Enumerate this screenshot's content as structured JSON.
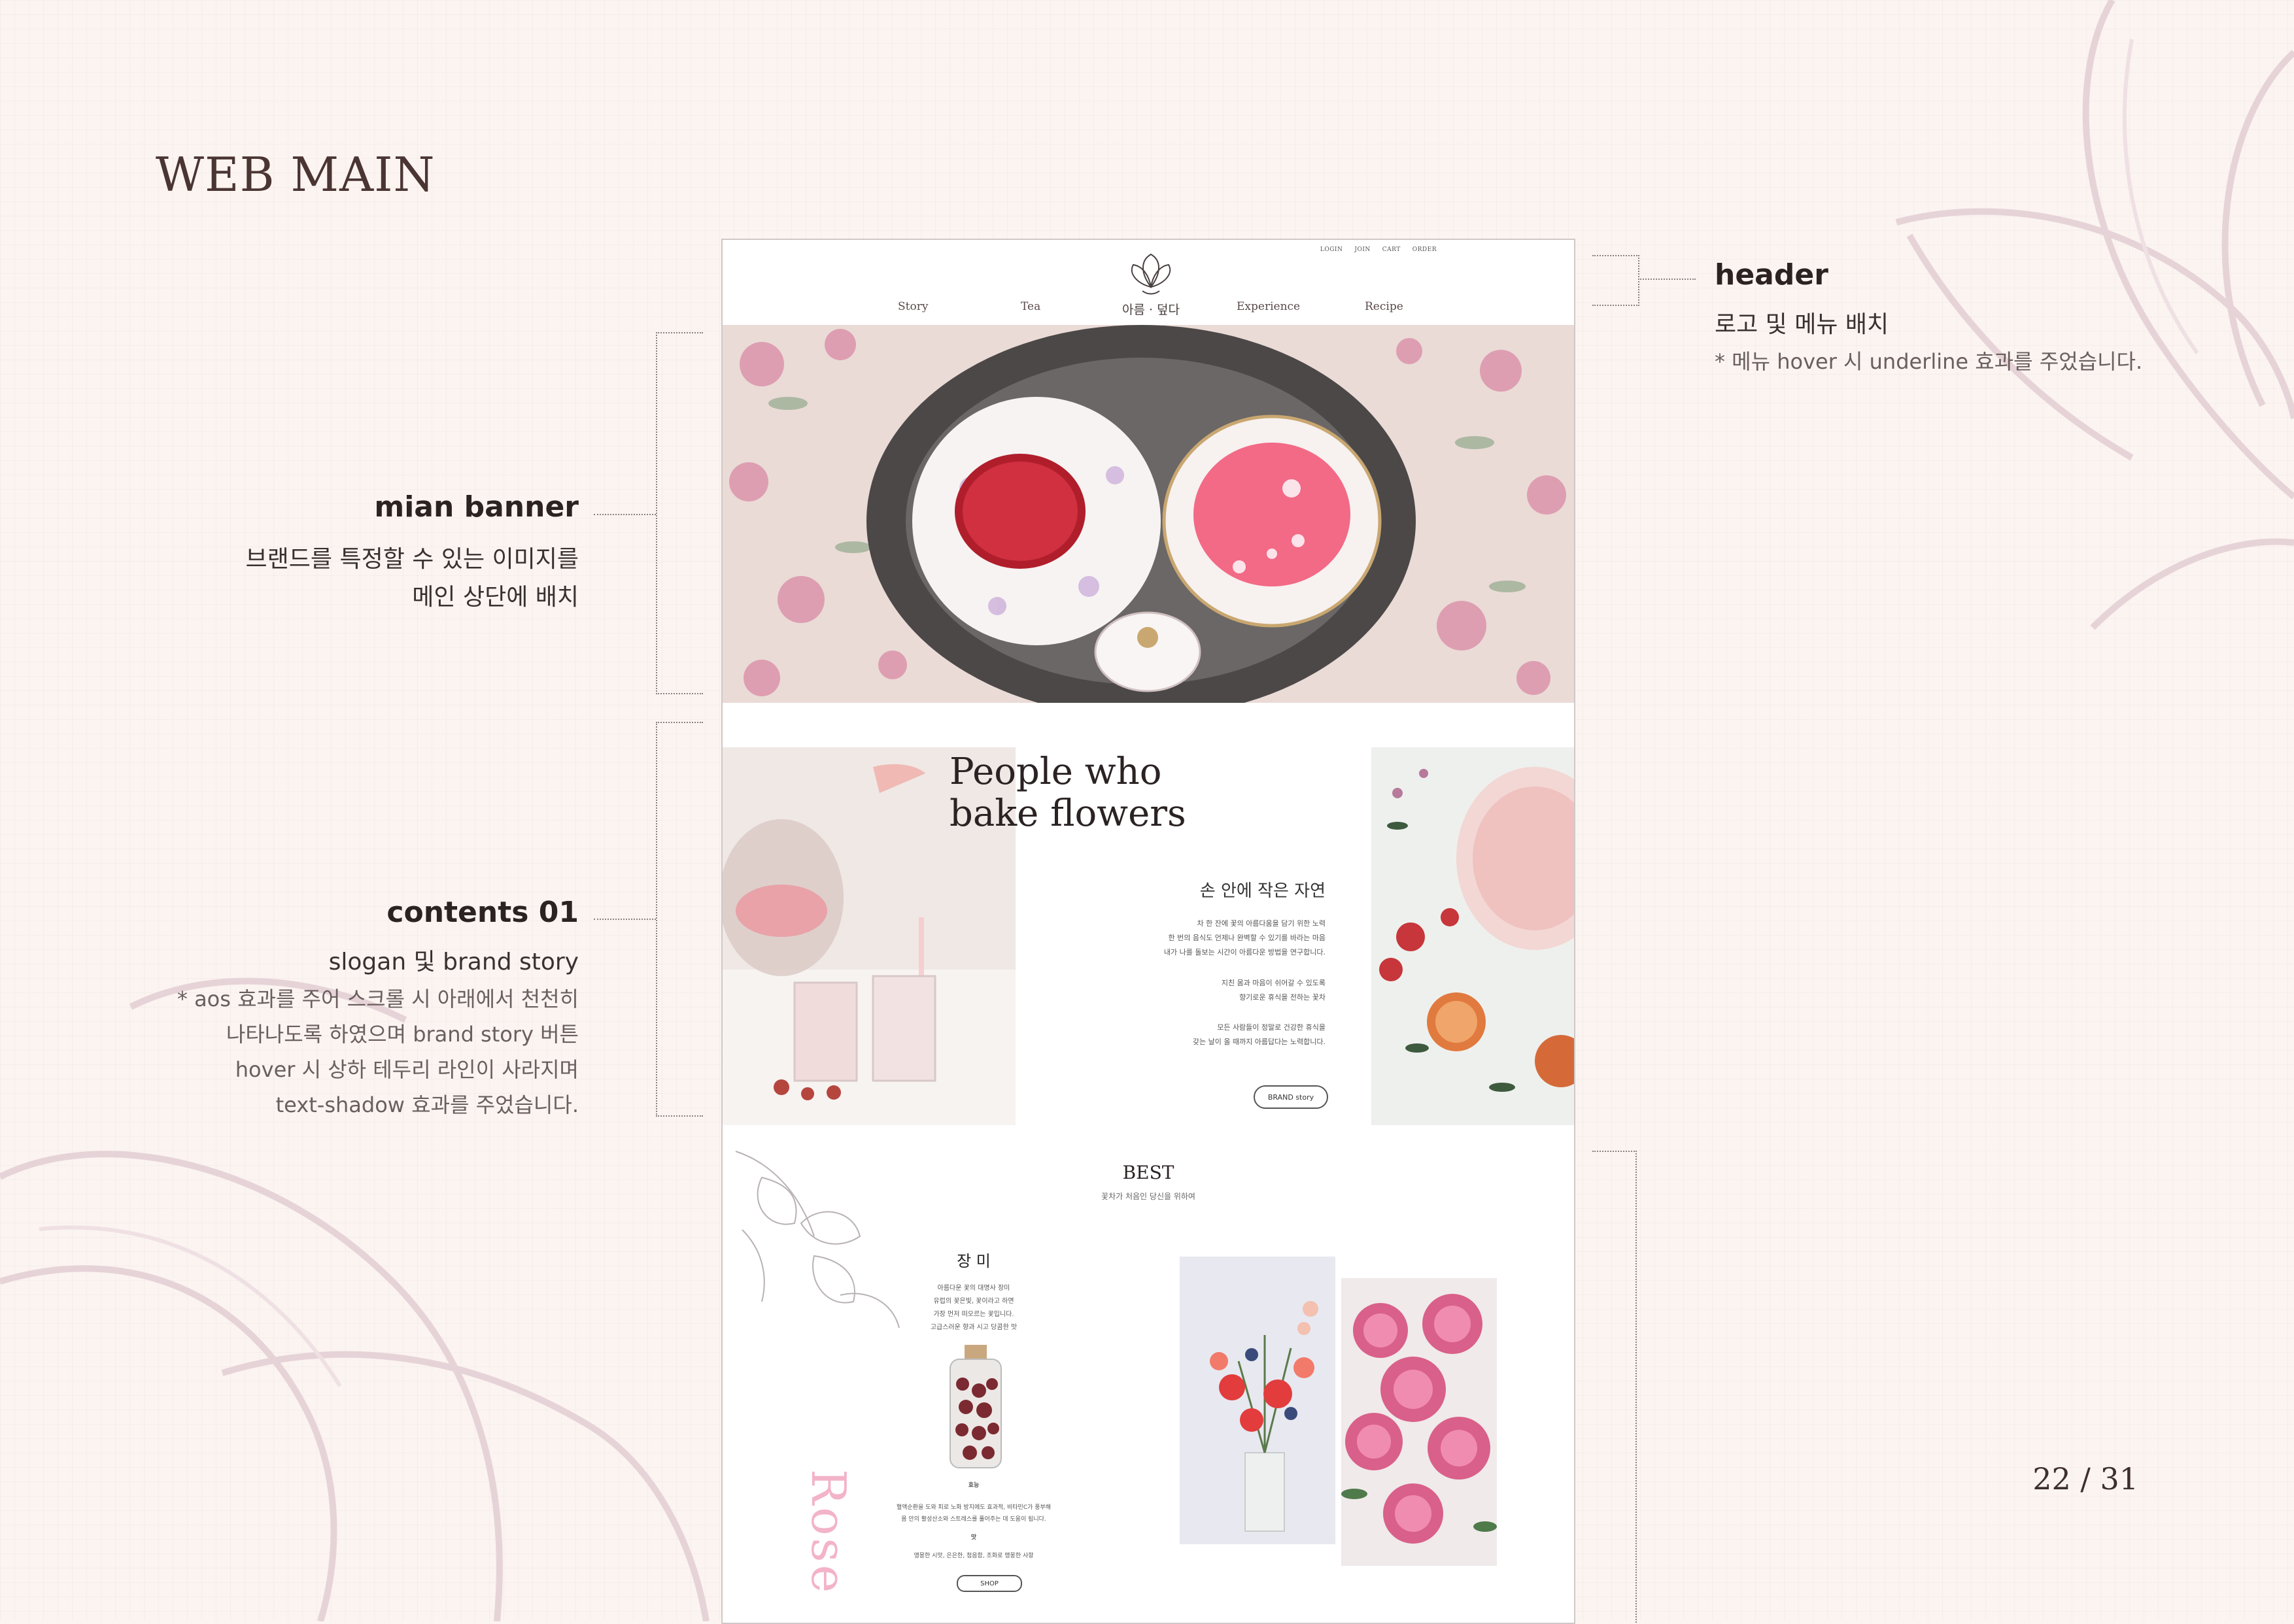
{
  "slide": {
    "title": "WEB MAIN",
    "page": "22 / 31"
  },
  "annotations": {
    "header": {
      "title": "header",
      "desc": "로고 및 메뉴 배치",
      "note": "* 메뉴 hover 시 underline 효과를 주었습니다."
    },
    "banner": {
      "title": "mian banner",
      "desc_line1": "브랜드를 특정할 수 있는 이미지를",
      "desc_line2": "메인 상단에 배치"
    },
    "contents01": {
      "title": "contents 01",
      "desc": "slogan 및 brand story",
      "note_line1": "* aos 효과를 주어 스크롤 시 아래에서 천천히",
      "note_line2": "나타나도록 하였으며 brand story 버튼",
      "note_line3": "hover 시 상하 테두리 라인이 사라지며",
      "note_line4": "text-shadow 효과를 주었습니다."
    }
  },
  "mockup": {
    "util_menu": [
      "LOGIN",
      "JOIN",
      "CART",
      "ORDER"
    ],
    "nav": [
      "Story",
      "Tea",
      "Experience",
      "Recipe"
    ],
    "logo_text": "아름 · 덮다",
    "slogan_line1": "People who",
    "slogan_line2": "bake flowers",
    "story_title": "손 안에 작은 자연",
    "story_p1_l1": "차 한 잔에 꽃의 아름다움을 담기 위한 노력",
    "story_p1_l2": "한 번의 음식도 언제나 완벽할 수 있기를 바라는 마음",
    "story_p1_l3": "내가 나를 돌보는 시간이 아름다운 방법을 연구합니다.",
    "story_p2_l1": "지친 몸과 마음이 쉬어갈 수 있도록",
    "story_p2_l2": "향기로운 휴식을 전하는 꽃차",
    "story_p3_l1": "모든 사람들이 정말로 건강한 휴식을",
    "story_p3_l2": "갖는 날이 올 때까지 아름답다는 노력합니다.",
    "brand_button": "BRAND story",
    "best_title": "BEST",
    "best_sub": "꽃차가 처음인 당신을 위하여",
    "product_title": "장 미",
    "product_desc_l1": "아름다운 꽃의 대명사 장미",
    "product_desc_l2": "유럽의 꽃은빛, 꽃이라고 하면",
    "product_desc_l3": "가장 먼저 떠오르는 꽃입니다.",
    "product_desc_l4": "고급스러운 향과 시고 당콤한 맛",
    "effect_label": "효능",
    "effect_l1": "혈액순환을 도와 피로 노화 방지에도 효과적, 비타민C가 풍부해",
    "effect_l2": "몸 안의 활성산소와 스트레스를 풀어주는 데 도움이 됩니다.",
    "taste_label": "맛",
    "taste_l1": "앵몽한 시맛, 은은한, 첨음함, 조화로 맹몽한 사항",
    "shop_button": "SHOP",
    "rose_text": "Rose"
  },
  "colors": {
    "background": "#fbf4f1",
    "title_brown": "#4a3533",
    "rose_pink": "#f3b3c8"
  }
}
